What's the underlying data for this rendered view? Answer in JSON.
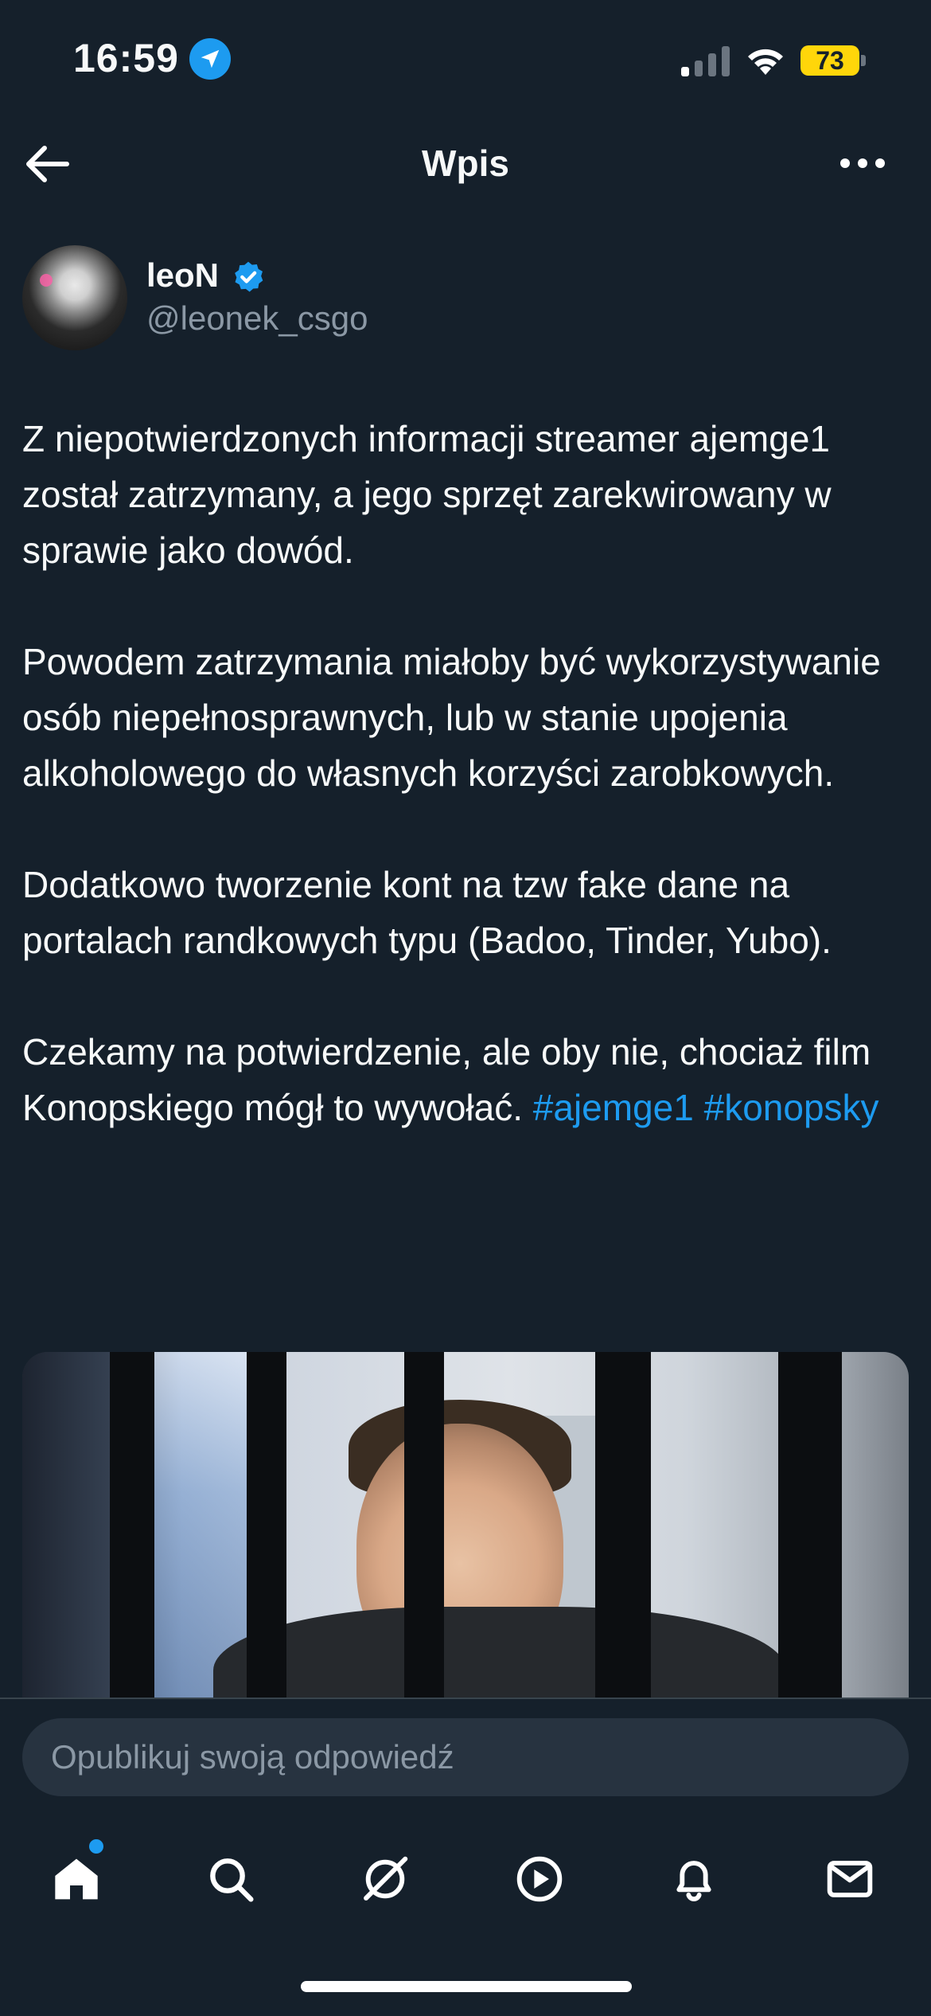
{
  "status_bar": {
    "time": "16:59",
    "battery": "73",
    "icons": [
      "location-arrow-icon",
      "signal-icon",
      "wifi-icon",
      "battery-icon"
    ]
  },
  "header": {
    "title": "Wpis",
    "back_icon": "arrow-left-icon",
    "more_icon": "more-horizontal-icon"
  },
  "author": {
    "name": "leoN",
    "handle": "@leonek_csgo",
    "verified": true
  },
  "tweet": {
    "paragraphs": [
      "Z niepotwierdzonych informacji streamer ajemge1 został zatrzymany, a jego sprzęt zarekwirowany w sprawie jako dowód.",
      "Powodem zatrzymania miałoby być wykorzystywanie osób niepełnosprawnych, lub w stanie upojenia alkoholowego do własnych korzyści zarobkowych.",
      "Dodatkowo tworzenie kont na tzw fake dane na portalach randkowych typu (Badoo, Tinder, Yubo)."
    ],
    "last_paragraph_text": "Czekamy na potwierdzenie, ale oby nie, chociaż film Konopskiego mógł to wywołać. ",
    "hashtags": [
      "#ajemge1",
      "#konopsky"
    ]
  },
  "reply": {
    "placeholder": "Opublikuj swoją odpowiedź"
  },
  "tabs": [
    {
      "icon": "home-icon",
      "active": true
    },
    {
      "icon": "search-icon"
    },
    {
      "icon": "grok-icon"
    },
    {
      "icon": "play-icon"
    },
    {
      "icon": "bell-icon"
    },
    {
      "icon": "mail-icon"
    }
  ],
  "colors": {
    "background": "#15202b",
    "accent": "#1d9bf0",
    "text": "#f7f9f9",
    "muted": "#8b98a5"
  }
}
